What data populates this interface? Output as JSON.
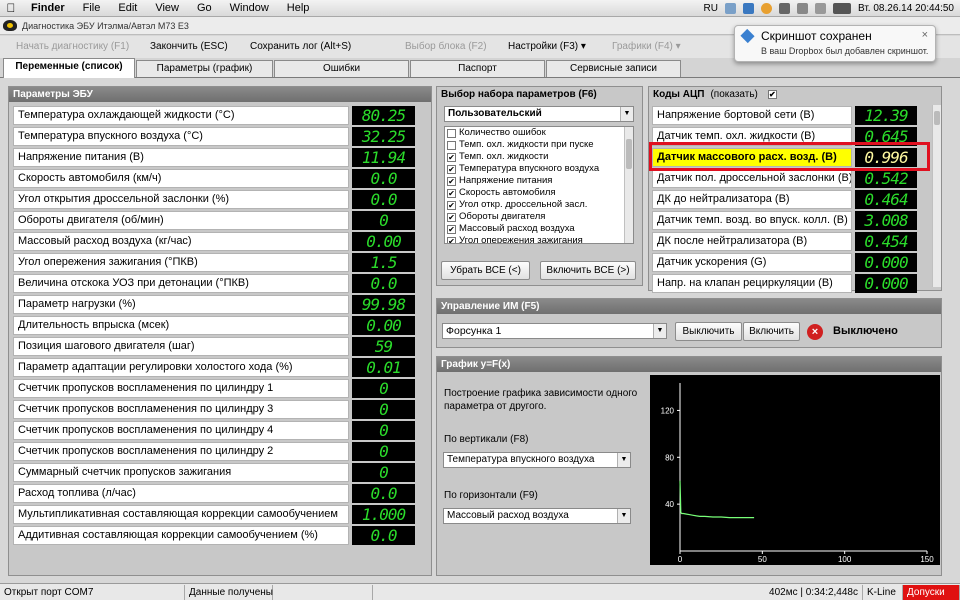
{
  "mac_menu": {
    "app": "Finder",
    "items": [
      "File",
      "Edit",
      "View",
      "Go",
      "Window",
      "Help"
    ],
    "lang": "RU",
    "datetime": "Вт. 08.26.14  20:44:50"
  },
  "window_title": "Диагностика ЭБУ Итэлма/Автэл M73 E3",
  "toolbar": {
    "start": "Начать диагностику (F1)",
    "finish": "Закончить (ESC)",
    "save_log": "Сохранить лог (Alt+S)",
    "select_block": "Выбор блока (F2)",
    "settings": "Настройки (F3) ▾",
    "graphs": "Графики (F4) ▾"
  },
  "tabs": [
    "Переменные (список)",
    "Параметры (график)",
    "Ошибки",
    "Паспорт",
    "Сервисные записи"
  ],
  "ecu": {
    "title": "Параметры ЭБУ",
    "params": [
      {
        "label": "Температура охлаждающей жидкости (°C)",
        "value": "80.25"
      },
      {
        "label": "Температура впускного воздуха (°C)",
        "value": "32.25"
      },
      {
        "label": "Напряжение питания (В)",
        "value": "11.94"
      },
      {
        "label": "Скорость автомобиля (км/ч)",
        "value": "0.0"
      },
      {
        "label": "Угол открытия дроссельной заслонки (%)",
        "value": "0.0"
      },
      {
        "label": "Обороты двигателя (об/мин)",
        "value": "0"
      },
      {
        "label": "Массовый расход воздуха (кг/час)",
        "value": "0.00"
      },
      {
        "label": "Угол опережения зажигания (°ПКВ)",
        "value": "1.5"
      },
      {
        "label": "Величина отскока УОЗ при детонации (°ПКВ)",
        "value": "0.0"
      },
      {
        "label": "Параметр нагрузки (%)",
        "value": "99.98"
      },
      {
        "label": "Длительность впрыска (мсек)",
        "value": "0.00"
      },
      {
        "label": "Позиция шагового двигателя (шаг)",
        "value": "59"
      },
      {
        "label": "Параметр адаптации регулировки холостого хода (%)",
        "value": "0.01"
      },
      {
        "label": "Счетчик пропусков воспламенения по цилиндру 1",
        "value": "0"
      },
      {
        "label": "Счетчик пропусков воспламенения по цилиндру 3",
        "value": "0"
      },
      {
        "label": "Счетчик пропусков воспламенения по цилиндру 4",
        "value": "0"
      },
      {
        "label": "Счетчик пропусков воспламенения по цилиндру 2",
        "value": "0"
      },
      {
        "label": "Суммарный счетчик пропусков зажигания",
        "value": "0"
      },
      {
        "label": "Расход топлива (л/час)",
        "value": "0.0"
      },
      {
        "label": "Мультипликативная составляющая коррекции самообучением",
        "value": "1.000"
      },
      {
        "label": "Аддитивная составляющая коррекции самообучением (%)",
        "value": "0.0"
      }
    ]
  },
  "selector": {
    "title": "Выбор набора параметров (F6)",
    "preset": "Пользовательский",
    "items": [
      {
        "label": "Количество ошибок",
        "checked": false
      },
      {
        "label": "Темп. охл. жидкости при пуске",
        "checked": false
      },
      {
        "label": "Темп. охл. жидкости",
        "checked": true
      },
      {
        "label": "Температура впускного воздуха",
        "checked": true
      },
      {
        "label": "Напряжение питания",
        "checked": true
      },
      {
        "label": "Скорость автомобиля",
        "checked": true
      },
      {
        "label": "Угол откр. дроссельной засл.",
        "checked": true
      },
      {
        "label": "Обороты двигателя",
        "checked": true
      },
      {
        "label": "Массовый расход воздуха",
        "checked": true
      },
      {
        "label": "Угол опережения зажигания",
        "checked": true
      }
    ],
    "remove_all": "Убрать ВСЕ (<)",
    "add_all": "Включить ВСЕ (>)"
  },
  "adc": {
    "title": "Коды АЦП",
    "show_label": "(показать)",
    "show_checked": "✔",
    "rows": [
      {
        "label": "Напряжение бортовой сети (В)",
        "value": "12.39"
      },
      {
        "label": "Датчик темп. охл. жидкости (В)",
        "value": "0.645"
      },
      {
        "label": "Датчик массового расх. возд. (В)",
        "value": "0.996"
      },
      {
        "label": "Датчик пол. дроссельной заслонки (В)",
        "value": "0.542"
      },
      {
        "label": "ДК до нейтрализатора (В)",
        "value": "0.464"
      },
      {
        "label": "Датчик темп. возд. во впуск. колл. (В)",
        "value": "3.008"
      },
      {
        "label": "ДК после нейтрализатора (В)",
        "value": "0.454"
      },
      {
        "label": "Датчик ускорения (G)",
        "value": "0.000"
      },
      {
        "label": "Напр. на клапан рециркуляции (В)",
        "value": "0.000"
      }
    ]
  },
  "control": {
    "title": "Управление ИМ (F5)",
    "device": "Форсунка 1",
    "off_button": "Выключить",
    "on_button": "Включить",
    "state": "Выключено"
  },
  "graph": {
    "title": "График y=F(x)",
    "description": "Построение графика зависимости одного параметра от другого.",
    "vertical_label": "По вертикали (F8)",
    "vertical_value": "Температура впускного воздуха",
    "horizontal_label": "По горизонтали (F9)",
    "horizontal_value": "Массовый расход воздуха"
  },
  "chart_data": {
    "type": "line",
    "x": [
      0,
      0.3,
      0.5,
      1,
      2,
      4,
      6,
      8,
      10,
      12,
      15,
      20,
      25,
      30,
      35,
      40,
      45
    ],
    "series": [
      {
        "values": [
          60,
          44,
          33,
          32,
          32,
          31.5,
          31,
          30.5,
          30,
          29.5,
          29.5,
          29,
          29,
          28.5,
          28.5,
          28.5,
          28.5
        ]
      }
    ],
    "xlim": [
      0,
      150
    ],
    "ylim": [
      0,
      140
    ],
    "xticks": [
      "0",
      "50",
      "100",
      "150"
    ],
    "yticks": [
      "40",
      "80",
      "120"
    ],
    "colors": {
      "line": "#78ff78",
      "bg": "#000000",
      "axis": "#ffffff"
    }
  },
  "dropbox": {
    "title": "Скриншот сохранен",
    "message": "В ваш Dropbox был добавлен скриншот."
  },
  "status": {
    "port": "Открыт порт COM7",
    "data": "Данные получены",
    "timing": "402мс | 0:34:2,448с",
    "protocol": "K-Line",
    "tolerance": "Допуски"
  },
  "colors": {
    "accent_red": "#e01020",
    "highlight": "#ffff00",
    "digit_green": "#2bdc2b"
  }
}
